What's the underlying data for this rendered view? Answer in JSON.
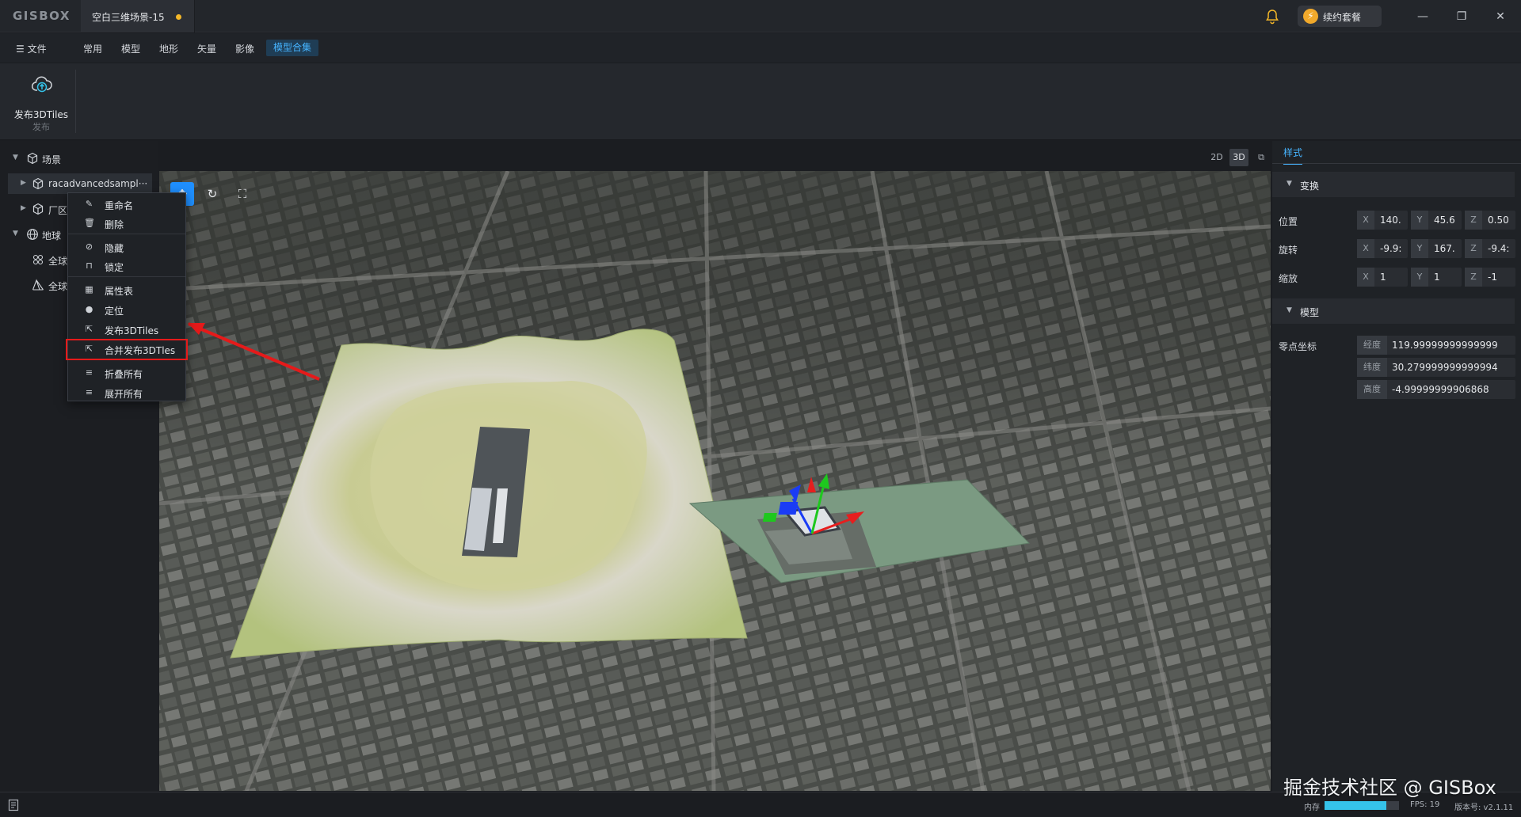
{
  "app": {
    "logo": "GISBOX",
    "doc_tab": "空白三维场景-15",
    "renew_label": "续约套餐"
  },
  "menubar": {
    "file": "文件",
    "items": [
      "常用",
      "模型",
      "地形",
      "矢量",
      "影像",
      "模型合集"
    ],
    "active_index": 5
  },
  "ribbon": {
    "publish_label": "发布3DTiles",
    "group_label": "发布"
  },
  "tree": {
    "scene": "场景",
    "model1": "racadvancedsampl···",
    "model2": "厂区",
    "earth": "地球",
    "layer1": "全球",
    "layer2": "全球"
  },
  "context_menu": {
    "items": [
      "重命名",
      "删除",
      "隐藏",
      "锁定",
      "属性表",
      "定位",
      "发布3DTiles",
      "合并发布3DTles",
      "折叠所有",
      "展开所有"
    ],
    "highlighted_index": 7
  },
  "viewmode": {
    "items": [
      "2D",
      "3D",
      "⧉"
    ],
    "active_index": 1
  },
  "right_panel": {
    "tab": "样式",
    "transform": {
      "title": "变换",
      "position_label": "位置",
      "position": {
        "x": "140.",
        "y": "45.6",
        "z": "0.50"
      },
      "rotation_label": "旋转",
      "rotation": {
        "x": "-9.9:",
        "y": "167.",
        "z": "-9.4:"
      },
      "scale_label": "缩放",
      "scale": {
        "x": "1",
        "y": "1",
        "z": "-1"
      }
    },
    "model": {
      "title": "模型",
      "origin_label": "零点坐标",
      "lon_label": "经度",
      "lon": "119.99999999999999",
      "lat_label": "纬度",
      "lat": "30.279999999999994",
      "alt_label": "高度",
      "alt": "-4.99999999906868"
    }
  },
  "status": {
    "memory_label": "内存",
    "memory_fraction": 0.83,
    "fps": "FPS: 19",
    "version": "版本号: v2.1.11"
  },
  "watermark": "掘金技术社区 @ GISBox"
}
